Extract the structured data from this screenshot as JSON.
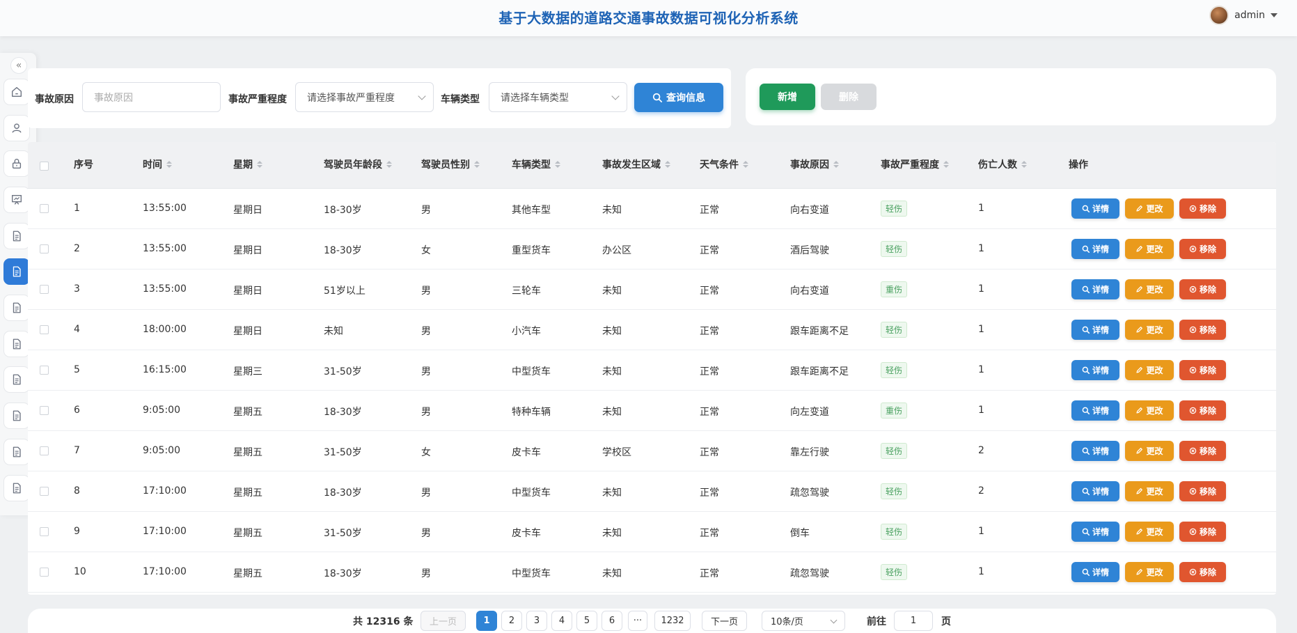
{
  "app": {
    "title": "基于大数据的道路交通事故数据可视化分析系统"
  },
  "user": {
    "name": "admin"
  },
  "sidebar": {
    "items": [
      {
        "icon": "home-icon"
      },
      {
        "icon": "user-icon"
      },
      {
        "icon": "lock-icon"
      },
      {
        "icon": "presentation-icon"
      },
      {
        "icon": "document-icon"
      },
      {
        "icon": "document-icon",
        "active": true
      },
      {
        "icon": "document-icon"
      },
      {
        "icon": "document-icon"
      },
      {
        "icon": "document-icon"
      },
      {
        "icon": "document-icon"
      },
      {
        "icon": "document-icon"
      },
      {
        "icon": "document-icon"
      }
    ]
  },
  "search": {
    "cause_label": "事故原因",
    "cause_placeholder": "事故原因",
    "severity_label": "事故严重程度",
    "severity_placeholder": "请选择事故严重程度",
    "vehicle_label": "车辆类型",
    "vehicle_placeholder": "请选择车辆类型",
    "query_label": "查询信息"
  },
  "actions": {
    "add_label": "新增",
    "delete_label": "删除"
  },
  "table": {
    "headers": {
      "index": "序号",
      "time": "时间",
      "weekday": "星期",
      "age": "驾驶员年龄段",
      "gender": "驾驶员性别",
      "vehicle": "车辆类型",
      "area": "事故发生区域",
      "weather": "天气条件",
      "cause": "事故原因",
      "severity": "事故严重程度",
      "casualties": "伤亡人数",
      "ops": "操作"
    },
    "op_labels": {
      "detail": "详情",
      "edit": "更改",
      "remove": "移除"
    },
    "rows": [
      {
        "index": "1",
        "time": "13:55:00",
        "weekday": "星期日",
        "age": "18-30岁",
        "gender": "男",
        "vehicle": "其他车型",
        "area": "未知",
        "weather": "正常",
        "cause": "向右变道",
        "severity": "轻伤",
        "casualties": "1"
      },
      {
        "index": "2",
        "time": "13:55:00",
        "weekday": "星期日",
        "age": "18-30岁",
        "gender": "女",
        "vehicle": "重型货车",
        "area": "办公区",
        "weather": "正常",
        "cause": "酒后驾驶",
        "severity": "轻伤",
        "casualties": "1"
      },
      {
        "index": "3",
        "time": "13:55:00",
        "weekday": "星期日",
        "age": "51岁以上",
        "gender": "男",
        "vehicle": "三轮车",
        "area": "未知",
        "weather": "正常",
        "cause": "向右变道",
        "severity": "重伤",
        "casualties": "1"
      },
      {
        "index": "4",
        "time": "18:00:00",
        "weekday": "星期日",
        "age": "未知",
        "gender": "男",
        "vehicle": "小汽车",
        "area": "未知",
        "weather": "正常",
        "cause": "跟车距离不足",
        "severity": "轻伤",
        "casualties": "1"
      },
      {
        "index": "5",
        "time": "16:15:00",
        "weekday": "星期三",
        "age": "31-50岁",
        "gender": "男",
        "vehicle": "中型货车",
        "area": "未知",
        "weather": "正常",
        "cause": "跟车距离不足",
        "severity": "轻伤",
        "casualties": "1"
      },
      {
        "index": "6",
        "time": "9:05:00",
        "weekday": "星期五",
        "age": "18-30岁",
        "gender": "男",
        "vehicle": "特种车辆",
        "area": "未知",
        "weather": "正常",
        "cause": "向左变道",
        "severity": "重伤",
        "casualties": "1"
      },
      {
        "index": "7",
        "time": "9:05:00",
        "weekday": "星期五",
        "age": "31-50岁",
        "gender": "女",
        "vehicle": "皮卡车",
        "area": "学校区",
        "weather": "正常",
        "cause": "靠左行驶",
        "severity": "轻伤",
        "casualties": "2"
      },
      {
        "index": "8",
        "time": "17:10:00",
        "weekday": "星期五",
        "age": "18-30岁",
        "gender": "男",
        "vehicle": "中型货车",
        "area": "未知",
        "weather": "正常",
        "cause": "疏忽驾驶",
        "severity": "轻伤",
        "casualties": "2"
      },
      {
        "index": "9",
        "time": "17:10:00",
        "weekday": "星期五",
        "age": "31-50岁",
        "gender": "男",
        "vehicle": "皮卡车",
        "area": "未知",
        "weather": "正常",
        "cause": "倒车",
        "severity": "轻伤",
        "casualties": "1"
      },
      {
        "index": "10",
        "time": "17:10:00",
        "weekday": "星期五",
        "age": "18-30岁",
        "gender": "男",
        "vehicle": "中型货车",
        "area": "未知",
        "weather": "正常",
        "cause": "疏忽驾驶",
        "severity": "轻伤",
        "casualties": "1"
      }
    ]
  },
  "pagination": {
    "total_text": "共 12316 条",
    "prev": "上一页",
    "pages": [
      "1",
      "2",
      "3",
      "4",
      "5",
      "6"
    ],
    "ellipsis": "···",
    "last": "1232",
    "next": "下一页",
    "page_size": "10条/页",
    "goto_label": "前往",
    "goto_value": "1",
    "page_suffix": "页",
    "current_page": 1
  },
  "colors": {
    "primary": "#2f84d6",
    "success": "#1f9a5a",
    "warning": "#ea9a1b",
    "danger": "#e0562f",
    "title": "#1e63b5"
  }
}
